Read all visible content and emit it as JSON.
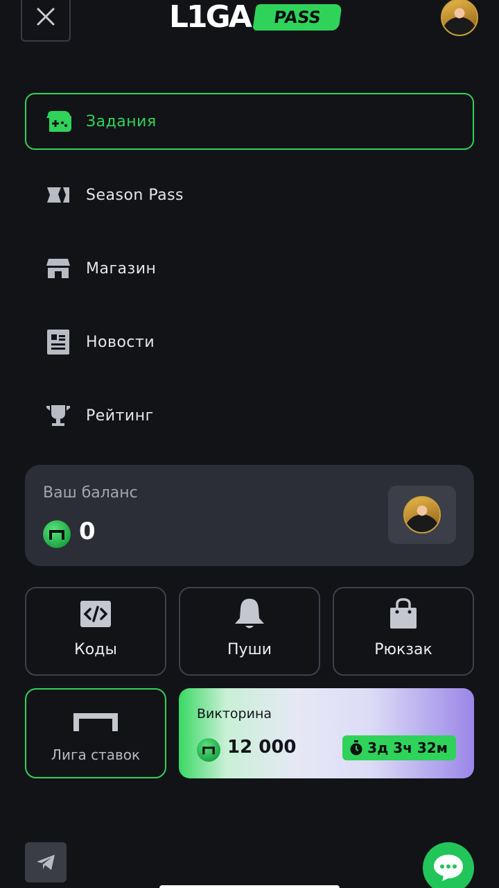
{
  "header": {
    "logo_main": "L1GA",
    "logo_badge": "PASS",
    "close_icon": "close-icon",
    "avatar_icon": "user-avatar"
  },
  "menu": [
    {
      "label": "Задания",
      "icon": "gamepad-icon",
      "active": true
    },
    {
      "label": "Season Pass",
      "icon": "ticket-icon",
      "active": false
    },
    {
      "label": "Магазин",
      "icon": "store-icon",
      "active": false
    },
    {
      "label": "Новости",
      "icon": "newspaper-icon",
      "active": false
    },
    {
      "label": "Рейтинг",
      "icon": "trophy-icon",
      "active": false
    }
  ],
  "balance": {
    "title": "Ваш баланс",
    "amount": "0",
    "coin_icon": "coin-icon"
  },
  "tiles": [
    {
      "label": "Коды",
      "icon": "code-icon"
    },
    {
      "label": "Пуши",
      "icon": "bell-icon"
    },
    {
      "label": "Рюкзак",
      "icon": "bag-icon"
    }
  ],
  "liga": {
    "label": "Лига ставок",
    "icon": "goal-icon"
  },
  "quiz": {
    "title": "Викторина",
    "amount": "12 000",
    "timer": "3д 3ч 32м",
    "timer_icon": "stopwatch-icon"
  },
  "bottom": {
    "telegram_icon": "telegram-icon",
    "chat_icon": "chat-icon"
  },
  "colors": {
    "background": "#121317",
    "accent": "#2fd35a",
    "card": "#2c2e37"
  }
}
